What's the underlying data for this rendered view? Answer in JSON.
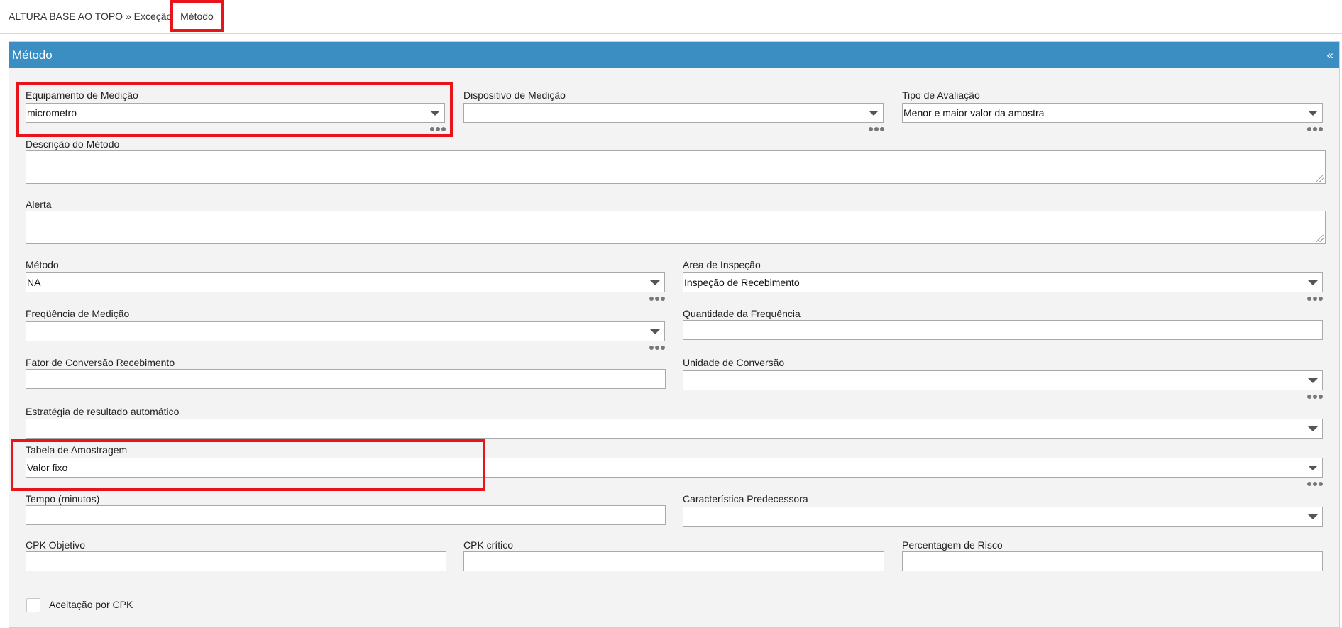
{
  "tabs": {
    "breadcrumb": "ALTURA BASE AO TOPO » Exceção",
    "active": "Método"
  },
  "panel": {
    "title": "Método",
    "collapse_glyph": "«"
  },
  "fields": {
    "equipamento": {
      "label": "Equipamento de Medição",
      "value": "micrometro"
    },
    "dispositivo": {
      "label": "Dispositivo de Medição",
      "value": ""
    },
    "tipo_avaliacao": {
      "label": "Tipo de Avaliação",
      "value": "Menor e maior valor da amostra"
    },
    "descricao": {
      "label": "Descrição do Método",
      "value": ""
    },
    "alerta": {
      "label": "Alerta",
      "value": ""
    },
    "metodo": {
      "label": "Método",
      "value": "NA"
    },
    "area_inspecao": {
      "label": "Área de Inspeção",
      "value": "Inspeção de Recebimento"
    },
    "frequencia": {
      "label": "Freqüência de Medição",
      "value": ""
    },
    "quantidade_frequencia": {
      "label": "Quantidade da Frequência",
      "value": ""
    },
    "fator_conversao": {
      "label": "Fator de Conversão Recebimento",
      "value": ""
    },
    "unidade_conversao": {
      "label": "Unidade de Conversão",
      "value": ""
    },
    "estrategia": {
      "label": "Estratégia de resultado automático",
      "value": ""
    },
    "tabela_amostragem": {
      "label": "Tabela de Amostragem",
      "value": "Valor fixo"
    },
    "tempo": {
      "label": "Tempo (minutos)",
      "value": ""
    },
    "caracteristica_predecessora": {
      "label": "Característica Predecessora",
      "value": ""
    },
    "cpk_objetivo": {
      "label": "CPK Objetivo",
      "value": ""
    },
    "cpk_critico": {
      "label": "CPK crítico",
      "value": ""
    },
    "percentagem_risco": {
      "label": "Percentagem de Risco",
      "value": ""
    },
    "aceitacao_cpk": {
      "label": "Aceitação por CPK",
      "checked": false
    }
  },
  "colors": {
    "header": "#3b8ec2",
    "highlight": "#e8141a",
    "panel_bg": "#f3f3f3"
  }
}
